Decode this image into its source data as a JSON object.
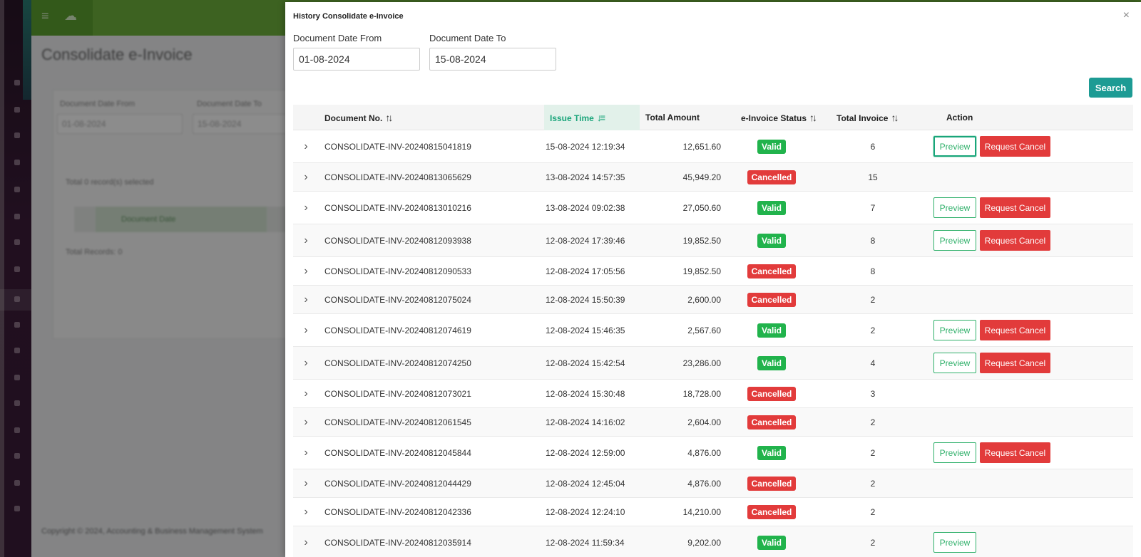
{
  "background": {
    "page_title": "Consolidate e-Invoice",
    "filter_from_label": "Document Date From",
    "filter_from_value": "01-08-2024",
    "filter_to_label": "Document Date To",
    "filter_to_value": "15-08-2024",
    "selected_text": "Total 0 record(s) selected",
    "column_document_date": "Document Date",
    "total_records": "Total Records: 0",
    "footer": "Copyright © 2024, Accounting & Business Management System"
  },
  "modal": {
    "title": "History Consolidate e-Invoice",
    "close_glyph": "×",
    "date_from": {
      "label": "Document Date From",
      "value": "01-08-2024"
    },
    "date_to": {
      "label": "Document Date To",
      "value": "15-08-2024"
    },
    "search_label": "Search",
    "columns": {
      "document_no": "Document No.",
      "issue_time": "Issue Time",
      "total_amount": "Total Amount",
      "status": "e-Invoice Status",
      "total_invoice": "Total Invoice",
      "action": "Action"
    },
    "sort_glyph": "↑↓",
    "sort_active_glyph": "↓≡",
    "expand_glyph": "›",
    "preview_label": "Preview",
    "request_cancel_label": "Request Cancel",
    "rows": [
      {
        "doc": "CONSOLIDATE-INV-20240815041819",
        "time": "15-08-2024 12:19:34",
        "amount": "12,651.60",
        "status": "Valid",
        "invoices": "6"
      },
      {
        "doc": "CONSOLIDATE-INV-20240813065629",
        "time": "13-08-2024 14:57:35",
        "amount": "45,949.20",
        "status": "Cancelled",
        "invoices": "15"
      },
      {
        "doc": "CONSOLIDATE-INV-20240813010216",
        "time": "13-08-2024 09:02:38",
        "amount": "27,050.60",
        "status": "Valid",
        "invoices": "7"
      },
      {
        "doc": "CONSOLIDATE-INV-20240812093938",
        "time": "12-08-2024 17:39:46",
        "amount": "19,852.50",
        "status": "Valid",
        "invoices": "8"
      },
      {
        "doc": "CONSOLIDATE-INV-20240812090533",
        "time": "12-08-2024 17:05:56",
        "amount": "19,852.50",
        "status": "Cancelled",
        "invoices": "8"
      },
      {
        "doc": "CONSOLIDATE-INV-20240812075024",
        "time": "12-08-2024 15:50:39",
        "amount": "2,600.00",
        "status": "Cancelled",
        "invoices": "2"
      },
      {
        "doc": "CONSOLIDATE-INV-20240812074619",
        "time": "12-08-2024 15:46:35",
        "amount": "2,567.60",
        "status": "Valid",
        "invoices": "2"
      },
      {
        "doc": "CONSOLIDATE-INV-20240812074250",
        "time": "12-08-2024 15:42:54",
        "amount": "23,286.00",
        "status": "Valid",
        "invoices": "4"
      },
      {
        "doc": "CONSOLIDATE-INV-20240812073021",
        "time": "12-08-2024 15:30:48",
        "amount": "18,728.00",
        "status": "Cancelled",
        "invoices": "3"
      },
      {
        "doc": "CONSOLIDATE-INV-20240812061545",
        "time": "12-08-2024 14:16:02",
        "amount": "2,604.00",
        "status": "Cancelled",
        "invoices": "2"
      },
      {
        "doc": "CONSOLIDATE-INV-20240812045844",
        "time": "12-08-2024 12:59:00",
        "amount": "4,876.00",
        "status": "Valid",
        "invoices": "2"
      },
      {
        "doc": "CONSOLIDATE-INV-20240812044429",
        "time": "12-08-2024 12:45:04",
        "amount": "4,876.00",
        "status": "Cancelled",
        "invoices": "2"
      },
      {
        "doc": "CONSOLIDATE-INV-20240812042336",
        "time": "12-08-2024 12:24:10",
        "amount": "14,210.00",
        "status": "Cancelled",
        "invoices": "2"
      },
      {
        "doc": "CONSOLIDATE-INV-20240812035914",
        "time": "12-08-2024 11:59:34",
        "amount": "9,202.00",
        "status": "Valid",
        "invoices": "2"
      }
    ]
  },
  "colors": {
    "teal": "#1d9b94",
    "valid": "#21b34c",
    "cancelled": "#e23b3b",
    "active_sort": "#19a57a",
    "topbar": "#6fb33c",
    "sidebar": "#3c1d3a"
  }
}
